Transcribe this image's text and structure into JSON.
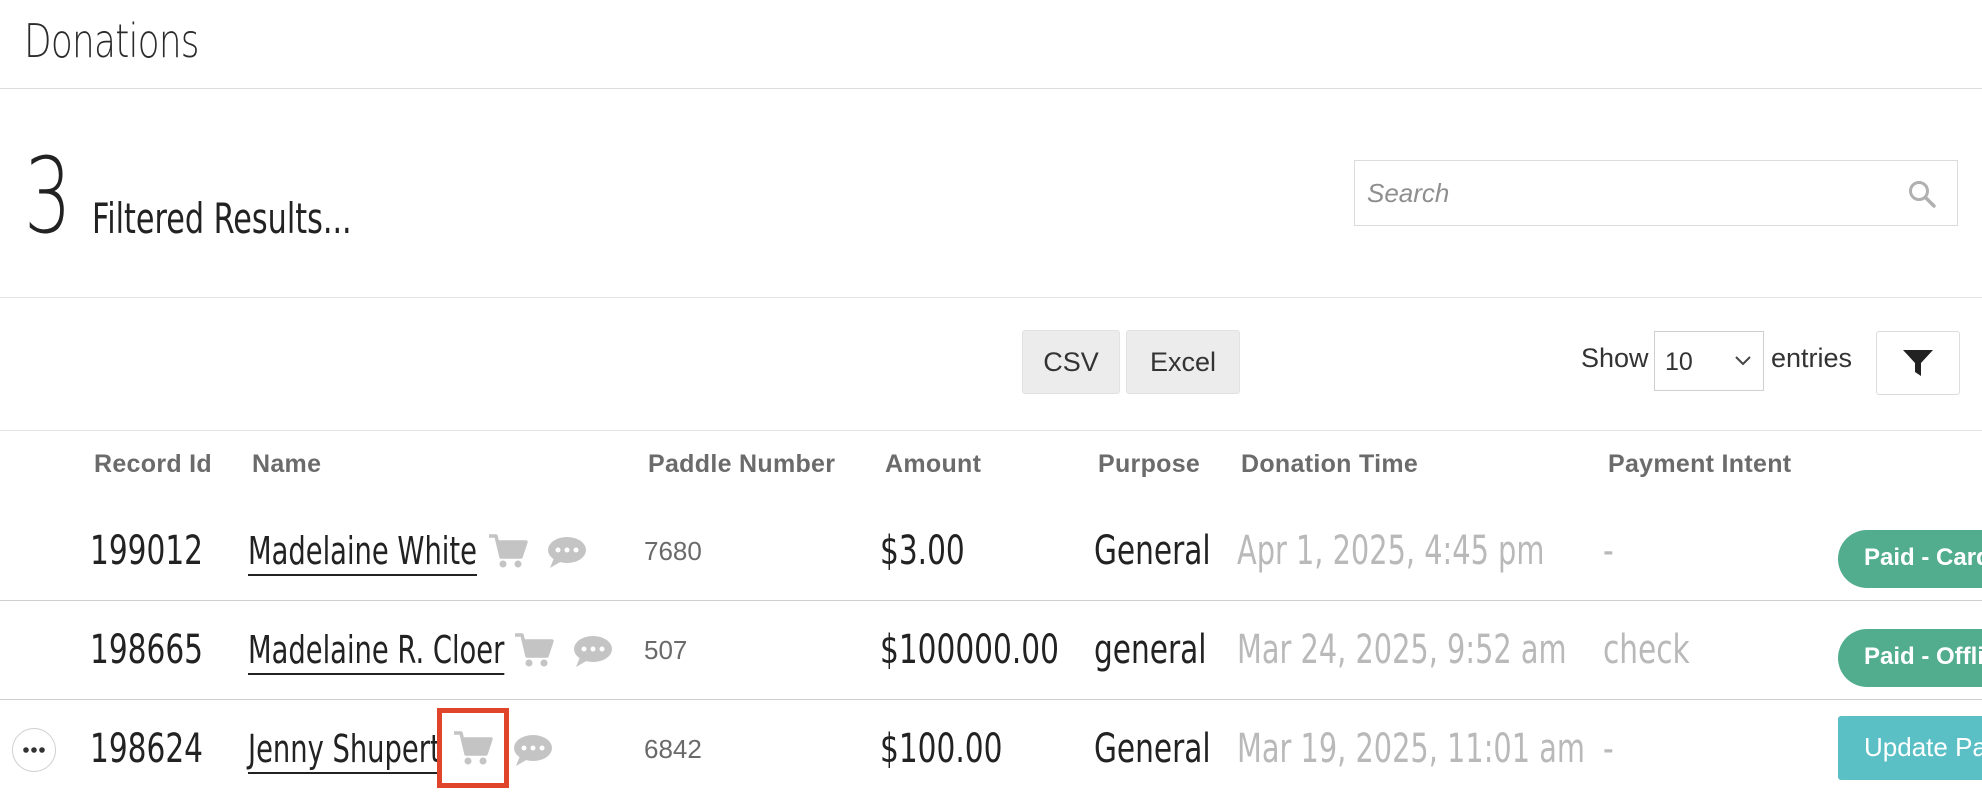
{
  "header": {
    "title": "Donations"
  },
  "results": {
    "count": "3",
    "label": "Filtered Results...",
    "search_placeholder": "Search"
  },
  "toolbar": {
    "csv_label": "CSV",
    "excel_label": "Excel",
    "show_label": "Show",
    "entries_value": "10",
    "entries_label": "entries"
  },
  "table": {
    "columns": [
      "Record Id",
      "Name",
      "Paddle Number",
      "Amount",
      "Purpose",
      "Donation Time",
      "Payment Intent"
    ],
    "rows": [
      {
        "record_id": "199012",
        "name": "Madelaine White",
        "paddle": "7680",
        "amount": "$3.00",
        "purpose": "General",
        "time": "Apr 1, 2025, 4:45 pm",
        "intent": "-",
        "status": "Paid - Card"
      },
      {
        "record_id": "198665",
        "name": "Madelaine R. Cloer",
        "paddle": "507",
        "amount": "$100000.00",
        "purpose": "general",
        "time": "Mar 24, 2025, 9:52 am",
        "intent": "check",
        "status": "Paid - Offline"
      },
      {
        "record_id": "198624",
        "name": "Jenny Shupert",
        "paddle": "6842",
        "amount": "$100.00",
        "purpose": "General",
        "time": "Mar 19, 2025, 11:01 am",
        "intent": "-",
        "status": "Update Payment"
      }
    ]
  },
  "colors": {
    "paid_badge": "#52ad8f",
    "update_button": "#5bc0c6",
    "highlight": "#e0452b",
    "icon_gray": "#c4c4c4"
  }
}
